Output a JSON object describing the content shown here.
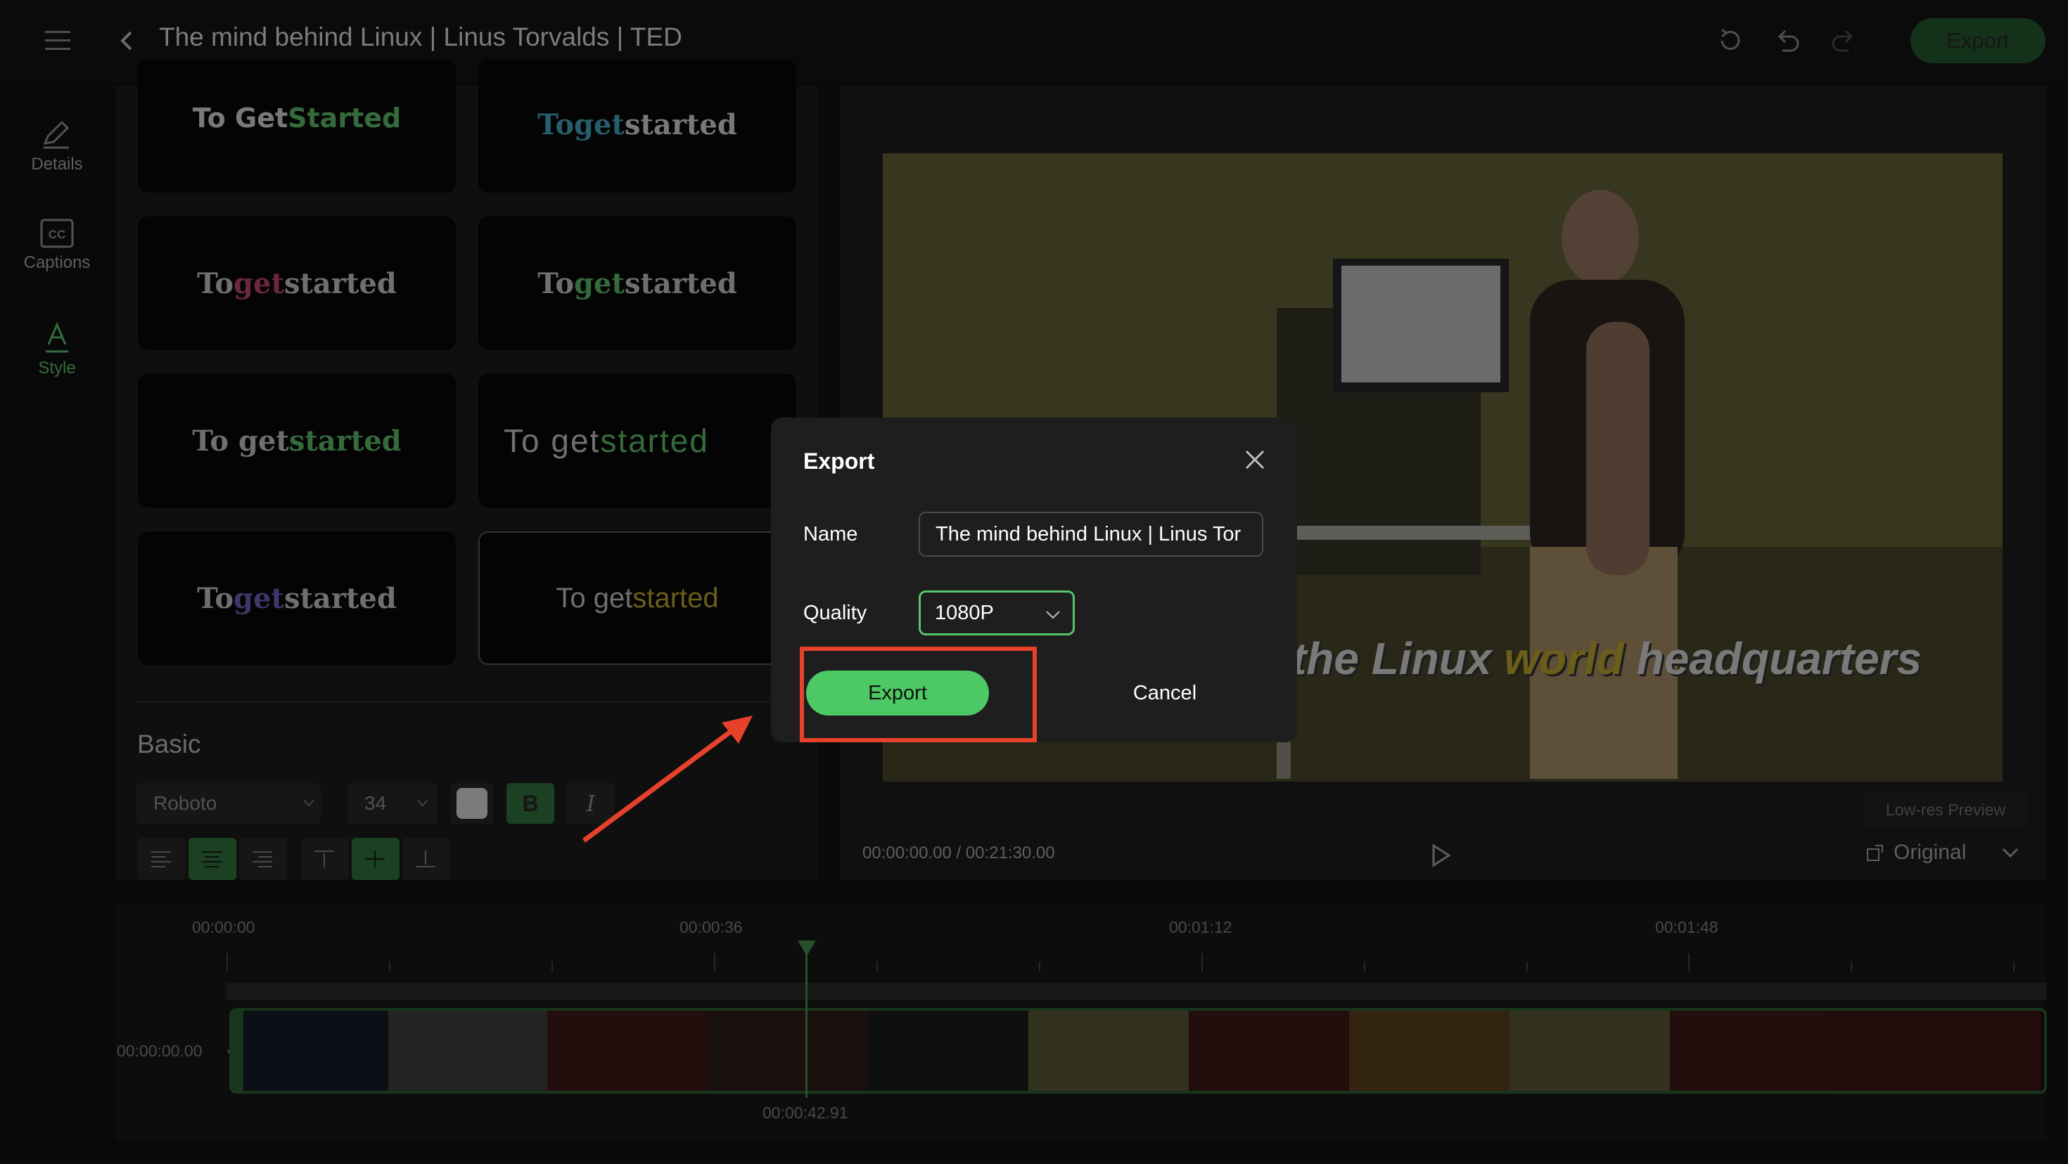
{
  "app": {
    "title": "The mind behind Linux | Linus Torvalds | TED",
    "export_label": "Export"
  },
  "sidebar": {
    "items": [
      {
        "label": "Details",
        "icon": "pencil-icon"
      },
      {
        "label": "Captions",
        "icon": "cc-icon"
      },
      {
        "label": "Style",
        "icon": "text-style-icon"
      }
    ]
  },
  "styles": {
    "presets": [
      {
        "text": "To Get Started",
        "word1": "To Get ",
        "word2": "Started",
        "color2": "#3d7a45"
      },
      {
        "text": "To get started",
        "word1": "To ",
        "word2": "get",
        "word3": " started",
        "color2": "#2d6b7a"
      },
      {
        "text": "To get started",
        "word1": "To ",
        "word2": "get",
        "word3": " started",
        "color2": "#7a2d4a"
      },
      {
        "text": "To get started",
        "word1": "To ",
        "word2": "get",
        "word3": " started",
        "color2": "#3d7a45"
      },
      {
        "text": "To get started",
        "word1": "To get ",
        "word2": "started",
        "color2": "#3d7a45"
      },
      {
        "text": "To get started",
        "word1": "To get ",
        "word2": "started",
        "color2": "#3d7a45"
      },
      {
        "text": "To get started",
        "word1": "To ",
        "word2": "get",
        "word3": " started",
        "color2": "#4a3d7a"
      },
      {
        "text": "To get started",
        "word1": "To get ",
        "word2": "started",
        "color2": "#7a6a1e"
      }
    ]
  },
  "basic": {
    "label": "Basic",
    "font": "Roboto",
    "size": "34",
    "bold": "B",
    "italic": "I"
  },
  "preview": {
    "caption_pre": "the Linux ",
    "caption_hl": "world",
    "caption_post": " headquarters",
    "lowres": "Low-res Preview",
    "timecode": "00:00:00.00 / 00:21:30.00",
    "ratio": "Original"
  },
  "timeline": {
    "markers": [
      "00:00:00",
      "00:00:36",
      "00:01:12",
      "00:01:48"
    ],
    "start_label": "00:00:00.00",
    "playhead_label": "00:00:42.91"
  },
  "dialog": {
    "title": "Export",
    "name_label": "Name",
    "name_value": "The mind behind Linux | Linus Tor",
    "quality_label": "Quality",
    "quality_value": "1080P",
    "export_label": "Export",
    "cancel_label": "Cancel"
  }
}
